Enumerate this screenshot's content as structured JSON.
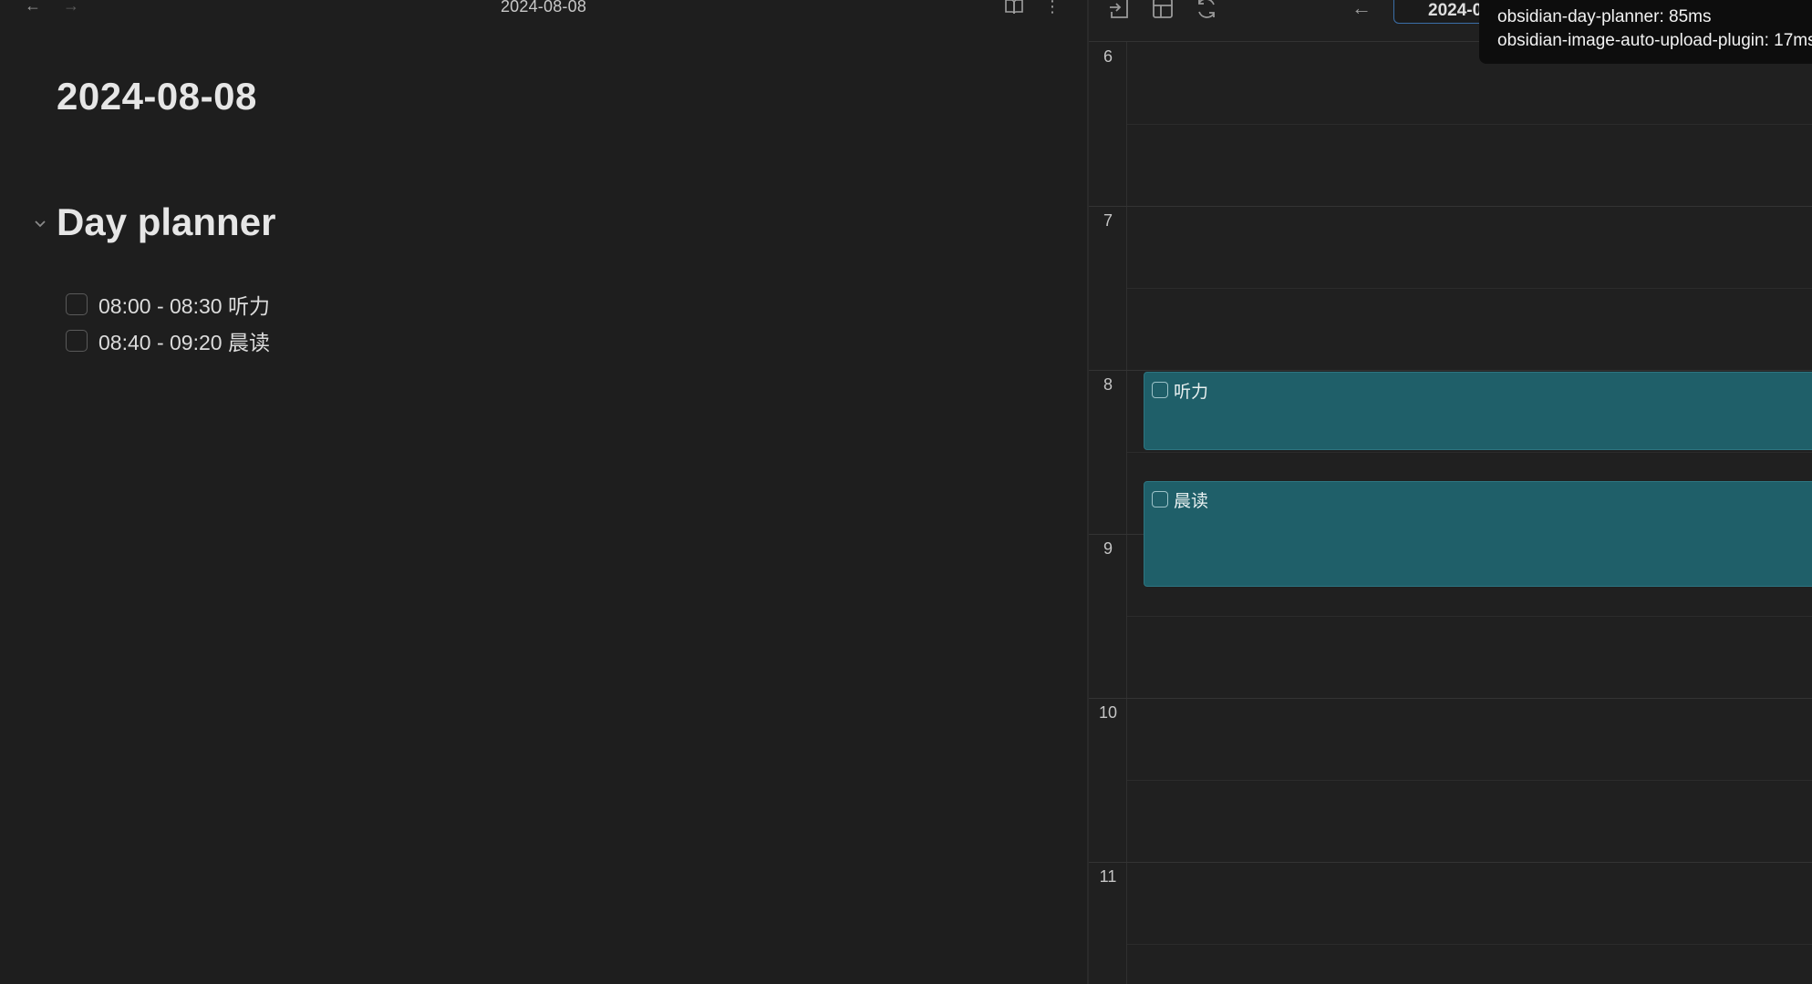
{
  "editor": {
    "header_title": "2024-08-08",
    "doc_title": "2024-08-08",
    "section_heading": "Day planner",
    "tasks": [
      {
        "text": "08:00 - 08:30 听力"
      },
      {
        "text": "08:40 - 09:20 晨读"
      }
    ]
  },
  "planner": {
    "date_value": "2024-0",
    "hours": [
      "6",
      "7",
      "8",
      "9",
      "10",
      "11"
    ],
    "events": [
      {
        "title": "听力"
      },
      {
        "title": "晨读"
      }
    ],
    "event_color": "#1f5f69"
  },
  "tooltip": {
    "lines": [
      "obsidian-day-planner: 85ms",
      "obsidian-image-auto-upload-plugin: 17ms"
    ]
  },
  "icons": {
    "back": "arrow-left-icon",
    "forward": "arrow-right-icon",
    "reading_view": "book-open-icon",
    "more": "more-vertical-icon",
    "export": "export-icon",
    "table": "table-icon",
    "refresh": "refresh-icon",
    "collapse": "chevron-down-icon"
  }
}
